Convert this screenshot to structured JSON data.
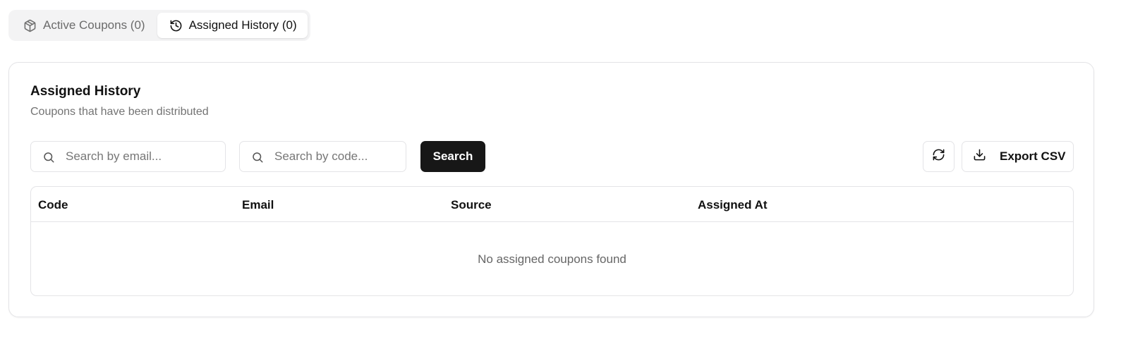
{
  "tabs": [
    {
      "label": "Active Coupons (0)",
      "icon": "package-icon",
      "active": false
    },
    {
      "label": "Assigned History (0)",
      "icon": "history-icon",
      "active": true
    }
  ],
  "card": {
    "title": "Assigned History",
    "subtitle": "Coupons that have been distributed"
  },
  "filters": {
    "email_placeholder": "Search by email...",
    "email_value": "",
    "code_placeholder": "Search by code...",
    "code_value": "",
    "search_label": "Search"
  },
  "actions": {
    "refresh_icon": "refresh-icon",
    "export_icon": "download-icon",
    "export_label": "Export CSV"
  },
  "table": {
    "columns": [
      "Code",
      "Email",
      "Source",
      "Assigned At"
    ],
    "rows": [],
    "empty_message": "No assigned coupons found"
  },
  "colors": {
    "primary_button": "#171717",
    "border": "#e4e4e7",
    "muted_text": "#737373"
  }
}
